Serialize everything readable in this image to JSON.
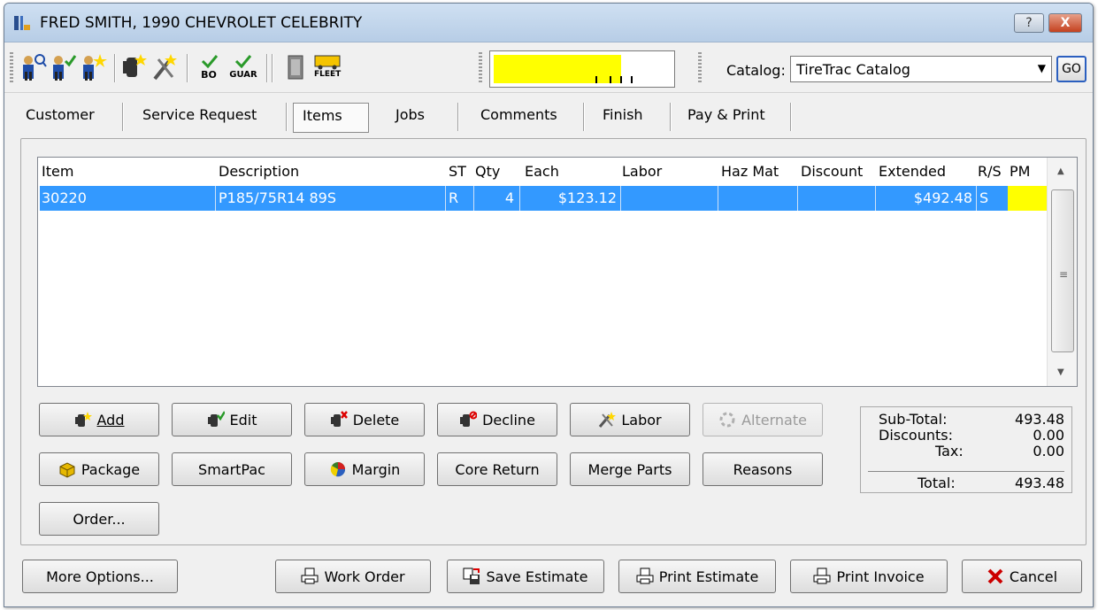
{
  "window": {
    "title": "FRED SMITH, 1990 CHEVROLET CELEBRITY",
    "help_label": "?",
    "close_label": "X"
  },
  "toolbar": {
    "icons": [
      "customer-lookup-icon",
      "customer-check-icon",
      "customer-add-icon",
      "item-add-icon",
      "labor-icon",
      "backorder-icon",
      "guarantee-icon",
      "document-icon",
      "fleet-icon"
    ],
    "bo_label": "BO",
    "guar_label": "GUAR",
    "fleet_label": "FLEET",
    "gauge_level": 0.72,
    "catalog_label": "Catalog:",
    "catalog_value": "TireTrac Catalog",
    "go_label": "GO"
  },
  "tabs": [
    "Customer",
    "Service Request",
    "Items",
    "Jobs",
    "Comments",
    "Finish",
    "Pay & Print"
  ],
  "active_tab": "Items",
  "grid": {
    "columns": [
      "Item",
      "Description",
      "ST",
      "Qty",
      "Each",
      "Labor",
      "Haz Mat",
      "Discount",
      "Extended",
      "R/S",
      "PM"
    ],
    "rows": [
      {
        "item": "30220",
        "description": "P185/75R14 89S",
        "st": "R",
        "qty": "4",
        "each": "$123.12",
        "labor": "",
        "haz_mat": "",
        "discount": "",
        "extended": "$492.48",
        "rs": "S",
        "pm": ""
      }
    ]
  },
  "buttons": {
    "add": "Add",
    "edit": "Edit",
    "delete": "Delete",
    "decline": "Decline",
    "labor": "Labor",
    "alternate": "Alternate",
    "package": "Package",
    "smartpac": "SmartPac",
    "margin": "Margin",
    "core_return": "Core Return",
    "merge_parts": "Merge Parts",
    "reasons": "Reasons",
    "order": "Order..."
  },
  "totals": {
    "subtotal_label": "Sub-Total:",
    "subtotal": "493.48",
    "discounts_label": "Discounts:",
    "discounts": "0.00",
    "tax_label": "Tax:",
    "tax": "0.00",
    "total_label": "Total:",
    "total": "493.48"
  },
  "footer": {
    "more_options": "More Options...",
    "work_order": "Work Order",
    "save_estimate": "Save Estimate",
    "print_estimate": "Print Estimate",
    "print_invoice": "Print Invoice",
    "cancel": "Cancel"
  },
  "colors": {
    "selection": "#3399ff",
    "highlight_yellow": "#ffff00",
    "cancel_x": "#cc0000"
  }
}
